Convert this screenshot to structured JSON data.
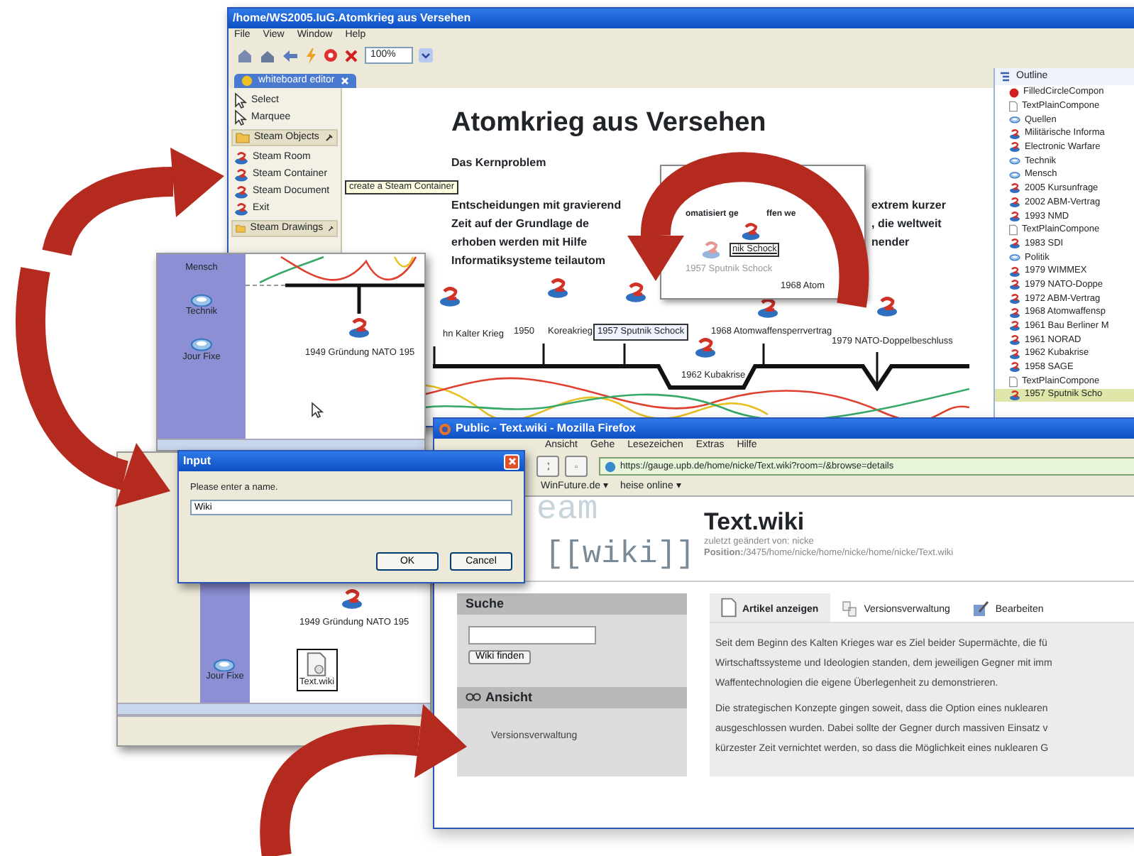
{
  "editor": {
    "title": "/home/WS2005.IuG.Atomkrieg aus Versehen",
    "menu": [
      "File",
      "View",
      "Window",
      "Help"
    ],
    "zoom": "100%",
    "tab": "whiteboard editor",
    "palette": [
      {
        "kind": "tool",
        "label": "Select"
      },
      {
        "kind": "tool",
        "label": "Marquee"
      },
      {
        "kind": "drawer",
        "label": "Steam Objects"
      },
      {
        "kind": "item",
        "label": "Steam Room"
      },
      {
        "kind": "item",
        "label": "Steam Container"
      },
      {
        "kind": "item",
        "label": "Steam Document"
      },
      {
        "kind": "item",
        "label": "Exit"
      },
      {
        "kind": "drawer",
        "label": "Steam Drawings"
      }
    ],
    "tooltip": "create a Steam Container",
    "heading": "Atomkrieg aus Versehen",
    "subheading": "Das Kernproblem",
    "text_left": [
      "Entscheidungen mit gravierend",
      "Zeit auf der Grundlage de",
      "erhoben werden mit Hilfe",
      "Informatiksysteme teilautom"
    ],
    "text_right": [
      "extrem kurzer",
      ", die weltweit",
      "nender"
    ],
    "preview": {
      "texts": [
        "omatisiert ge",
        "ffen we"
      ],
      "labels": [
        "nik Schock",
        "1957 Sputnik Schock",
        "1968 Atom"
      ]
    },
    "nodes": [
      {
        "label": "hn Kalter Krieg",
        "selected": false
      },
      {
        "year": "1950",
        "label": "Koreakrieg",
        "selected": false
      },
      {
        "label": "1957 Sputnik Schock",
        "selected": true
      },
      {
        "label": "1968 Atomwaffensperrvertrag",
        "selected": false
      },
      {
        "label": "1979 NATO-Doppelbeschluss",
        "selected": false
      },
      {
        "label": "1962 Kubakrise",
        "selected": false
      }
    ],
    "outline": {
      "title": "Outline",
      "items": [
        {
          "kind": "circle",
          "label": "FilledCircleCompon",
          "selected": false
        },
        {
          "kind": "text",
          "label": "TextPlainCompone",
          "selected": false
        },
        {
          "kind": "room",
          "label": "Quellen",
          "selected": false
        },
        {
          "kind": "node",
          "label": "Militärische Informa",
          "selected": false
        },
        {
          "kind": "node",
          "label": "Electronic Warfare",
          "selected": false
        },
        {
          "kind": "room",
          "label": "Technik",
          "selected": false
        },
        {
          "kind": "room",
          "label": "Mensch",
          "selected": false
        },
        {
          "kind": "node",
          "label": "2005 Kursunfrage",
          "selected": false
        },
        {
          "kind": "node",
          "label": "2002 ABM-Vertrag",
          "selected": false
        },
        {
          "kind": "node",
          "label": "1993 NMD",
          "selected": false
        },
        {
          "kind": "text",
          "label": "TextPlainCompone",
          "selected": false
        },
        {
          "kind": "node",
          "label": "1983 SDI",
          "selected": false
        },
        {
          "kind": "room",
          "label": "Politik",
          "selected": false
        },
        {
          "kind": "node",
          "label": "1979 WIMMEX",
          "selected": false
        },
        {
          "kind": "node",
          "label": "1979 NATO-Doppe",
          "selected": false
        },
        {
          "kind": "node",
          "label": "1972 ABM-Vertrag",
          "selected": false
        },
        {
          "kind": "node",
          "label": "1968 Atomwaffensp",
          "selected": false
        },
        {
          "kind": "node",
          "label": "1961 Bau Berliner M",
          "selected": false
        },
        {
          "kind": "node",
          "label": "1961 NORAD",
          "selected": false
        },
        {
          "kind": "node",
          "label": "1962 Kubakrise",
          "selected": false
        },
        {
          "kind": "node",
          "label": "1958 SAGE",
          "selected": false
        },
        {
          "kind": "text",
          "label": "TextPlainCompone",
          "selected": false
        },
        {
          "kind": "node",
          "label": "1957 Sputnik Scho",
          "selected": true
        }
      ]
    }
  },
  "whiteboard_top": {
    "sidebar": [
      {
        "kind": "label",
        "label": "Mensch"
      },
      {
        "kind": "room",
        "label": "Technik"
      },
      {
        "kind": "room",
        "label": "Jour Fixe"
      }
    ],
    "node": "1949 Gründung NATO 195"
  },
  "whiteboard_bottom": {
    "sidebar": [
      {
        "kind": "room",
        "label": "Jour Fixe"
      }
    ],
    "node": "1949 Gründung NATO 195",
    "document": "Text.wiki"
  },
  "dialog": {
    "title": "Input",
    "prompt": "Please enter a name.",
    "value": "Wiki",
    "buttons": [
      "OK",
      "Cancel"
    ]
  },
  "browser": {
    "title": "Public - Text.wiki - Mozilla Firefox",
    "menu": [
      "Ansicht",
      "Gehe",
      "Lesezeichen",
      "Extras",
      "Hilfe"
    ],
    "url": "https://gauge.upb.de/home/nicke/Text.wiki?room=/&browse=details",
    "bookmarks": [
      "WinFuture.de ▾",
      "heise online ▾"
    ],
    "logo_faded": "eam",
    "logo": "[[wiki]]",
    "page_title": "Text.wiki",
    "modified": "zuletzt geändert von: nicke",
    "position": "**Position:**/3475/home/nicke/home/nicke/home/nicke/Text.wiki",
    "search": {
      "title": "Suche",
      "button": "Wiki finden"
    },
    "view": {
      "title": "Ansicht",
      "items": [
        "Versionsverwaltung"
      ]
    },
    "tabs": [
      {
        "label": "Artikel anzeigen",
        "selected": true
      },
      {
        "label": "Versionsverwaltung",
        "selected": false
      },
      {
        "label": "Bearbeiten",
        "selected": false
      }
    ],
    "paragraphs": [
      [
        "Seit dem Beginn des Kalten Krieges war es Ziel beider Supermächte, die fü",
        "Wirtschaftssysteme und Ideologien standen, dem jeweiligen Gegner mit imm",
        "Waffentechnologien die eigene Überlegenheit zu demonstrieren."
      ],
      [
        "Die strategischen Konzepte gingen soweit, dass die Option eines nuklearen",
        "ausgeschlossen wurden. Dabei sollte der Gegner durch massiven Einsatz v",
        "kürzester Zeit vernichtet werden, so dass die Möglichkeit eines nuklearen G"
      ]
    ]
  }
}
